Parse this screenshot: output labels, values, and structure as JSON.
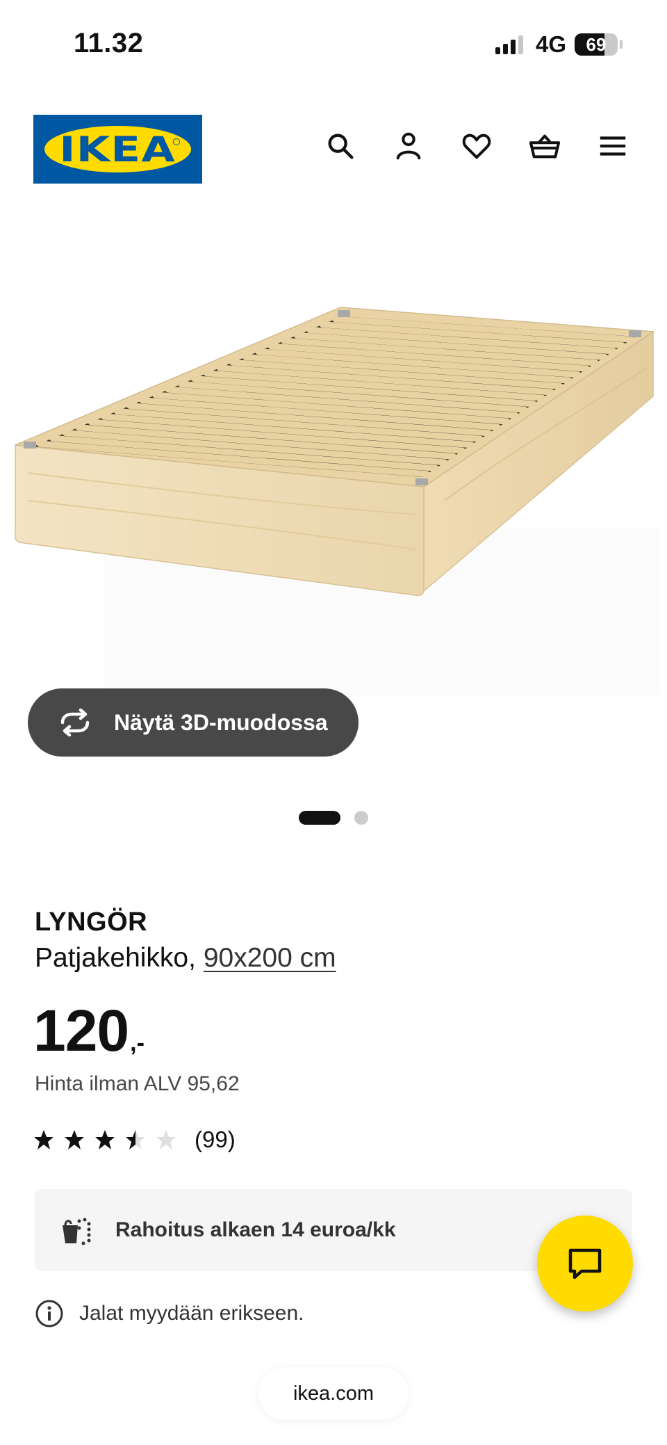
{
  "status_bar": {
    "time": "11.32",
    "network": "4G",
    "battery": "69",
    "battery_level_pct": 69
  },
  "header": {
    "logo_text": "IKEA",
    "icons": [
      "search-icon",
      "user-icon",
      "heart-icon",
      "basket-icon",
      "menu-icon"
    ]
  },
  "gallery": {
    "view_3d_label": "Näytä 3D-muodossa",
    "image_count": 2,
    "active_index": 0
  },
  "product": {
    "name": "LYNGÖR",
    "type": "Patjakehikko,",
    "size": "90x200 cm",
    "price": "120",
    "price_suffix": ",-",
    "vat_text": "Hinta ilman ALV 95,62",
    "rating": 3.5,
    "rating_max": 5,
    "review_count": "(99)"
  },
  "financing": {
    "label": "Rahoitus alkaen 14 euroa/kk"
  },
  "info": {
    "text": "Jalat myydään erikseen."
  },
  "browser": {
    "url": "ikea.com"
  },
  "colors": {
    "ikea_blue": "#0058a3",
    "ikea_yellow": "#ffdb00",
    "button_dark": "#484848",
    "panel_gray": "#f5f5f5"
  }
}
